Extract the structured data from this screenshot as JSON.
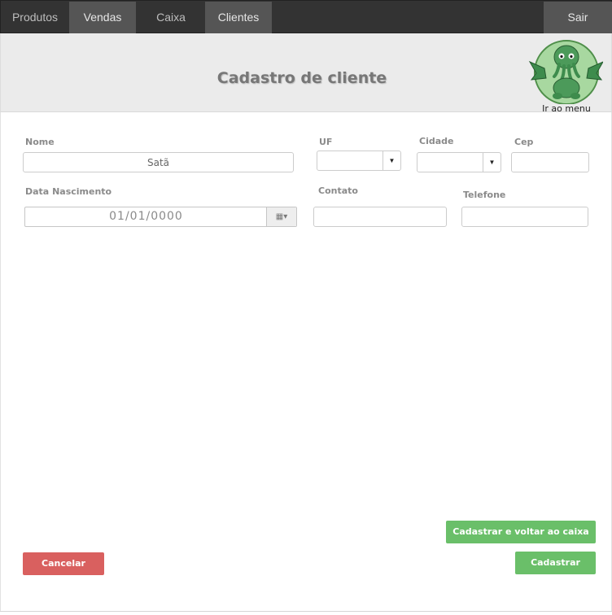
{
  "nav": {
    "tabs": [
      {
        "label": "Produtos"
      },
      {
        "label": "Vendas"
      },
      {
        "label": "Caixa"
      },
      {
        "label": "Clientes"
      }
    ],
    "logout_label": "Sair"
  },
  "header": {
    "title": "Cadastro de cliente",
    "menu_link": "Ir ao menu",
    "mascot_icon": "cthulhu-mascot-icon"
  },
  "form": {
    "nome": {
      "label": "Nome",
      "value": "Satã"
    },
    "uf": {
      "label": "UF",
      "value": ""
    },
    "cidade": {
      "label": "Cidade",
      "value": ""
    },
    "cep": {
      "label": "Cep",
      "value": ""
    },
    "data_nascimento": {
      "label": "Data Nascimento",
      "value": "01/01/0000"
    },
    "contato": {
      "label": "Contato",
      "value": ""
    },
    "telefone": {
      "label": "Telefone",
      "value": ""
    }
  },
  "actions": {
    "cadastrar_voltar": "Cadastrar e voltar ao caixa",
    "cadastrar": "Cadastrar",
    "cancelar": "Cancelar"
  },
  "colors": {
    "topbar": "#333333",
    "active_tab": "#555555",
    "header_bg": "#ebebeb",
    "green": "#6abf69",
    "red": "#d9605f"
  }
}
